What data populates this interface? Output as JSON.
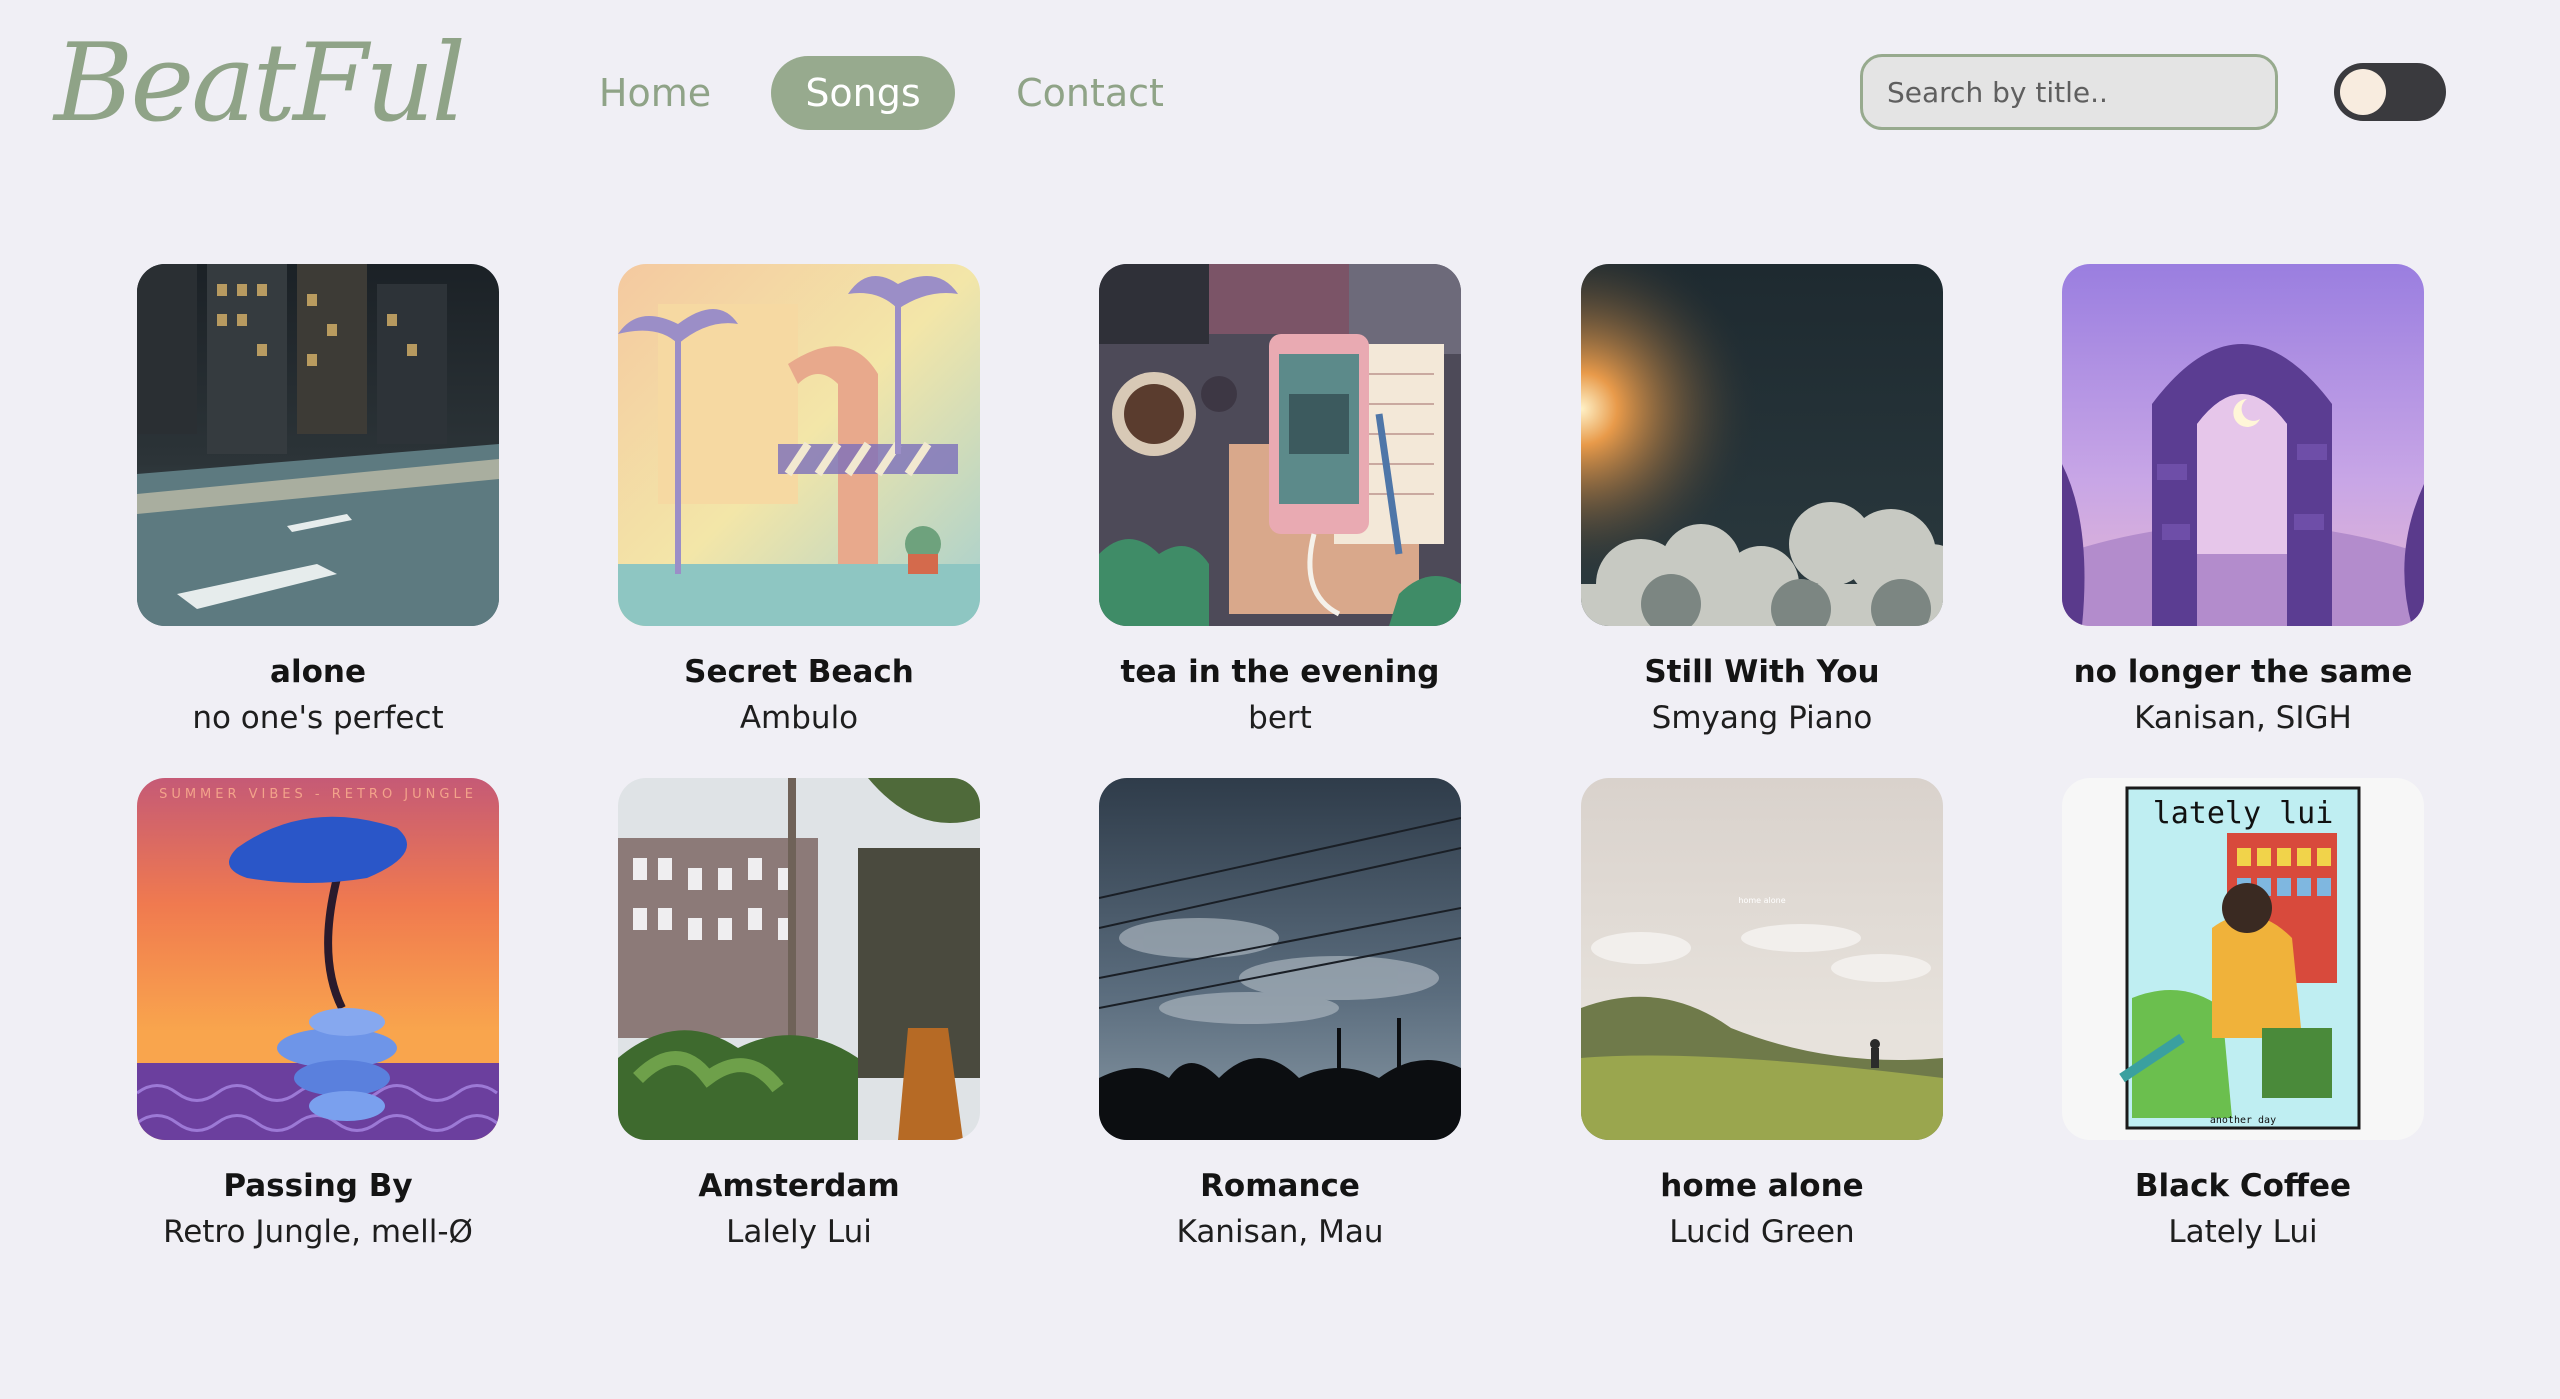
{
  "brand": {
    "logo": "BeatFul",
    "accent": "#97aa8e",
    "background": "#f0eff5"
  },
  "nav": {
    "home": "Home",
    "songs": "Songs",
    "contact": "Contact",
    "active": "Songs"
  },
  "search": {
    "placeholder": "Search by title..",
    "value": ""
  },
  "theme_toggle": {
    "state": "off"
  },
  "songs": [
    {
      "title": "alone",
      "artist": "no one's perfect"
    },
    {
      "title": "Secret Beach",
      "artist": "Ambulo"
    },
    {
      "title": "tea in the evening",
      "artist": "bert"
    },
    {
      "title": "Still With You",
      "artist": "Smyang Piano"
    },
    {
      "title": "no longer the same",
      "artist": "Kanisan, SIGH"
    },
    {
      "title": "Passing By",
      "artist": "Retro Jungle, mell-Ø"
    },
    {
      "title": "Amsterdam",
      "artist": "Lalely Lui"
    },
    {
      "title": "Romance",
      "artist": "Kanisan, Mau"
    },
    {
      "title": "home alone",
      "artist": "Lucid Green"
    },
    {
      "title": "Black Coffee",
      "artist": "Lately Lui"
    }
  ],
  "cover_texts": {
    "passing_by": "SUMMER VIBES - RETRO JUNGLE",
    "home_alone": "home alone",
    "black_coffee_top": "lately lui",
    "black_coffee_bottom": "another day"
  }
}
